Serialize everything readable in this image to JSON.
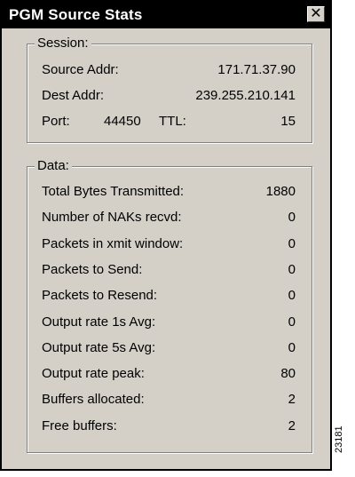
{
  "window": {
    "title": "PGM Source Stats",
    "close_glyph": "✕"
  },
  "session": {
    "label": "Session:",
    "source_addr_label": "Source Addr:",
    "source_addr_value": "171.71.37.90",
    "dest_addr_label": "Dest Addr:",
    "dest_addr_value": "239.255.210.141",
    "port_label": "Port:",
    "port_value": "44450",
    "ttl_label": "TTL:",
    "ttl_value": "15"
  },
  "data": {
    "label": "Data:",
    "rows": [
      {
        "label": "Total Bytes Transmitted:",
        "value": "1880"
      },
      {
        "label": "Number of NAKs recvd:",
        "value": "0"
      },
      {
        "label": "Packets in xmit window:",
        "value": "0"
      },
      {
        "label": "Packets to Send:",
        "value": "0"
      },
      {
        "label": "Packets to Resend:",
        "value": "0"
      },
      {
        "label": "Output rate 1s Avg:",
        "value": "0"
      },
      {
        "label": "Output rate 5s Avg:",
        "value": "0"
      },
      {
        "label": "Output rate peak:",
        "value": "80"
      },
      {
        "label": "Buffers allocated:",
        "value": "2"
      },
      {
        "label": "Free buffers:",
        "value": "2"
      }
    ]
  },
  "figure_id": "23181",
  "icons": {
    "close": "close-icon"
  }
}
